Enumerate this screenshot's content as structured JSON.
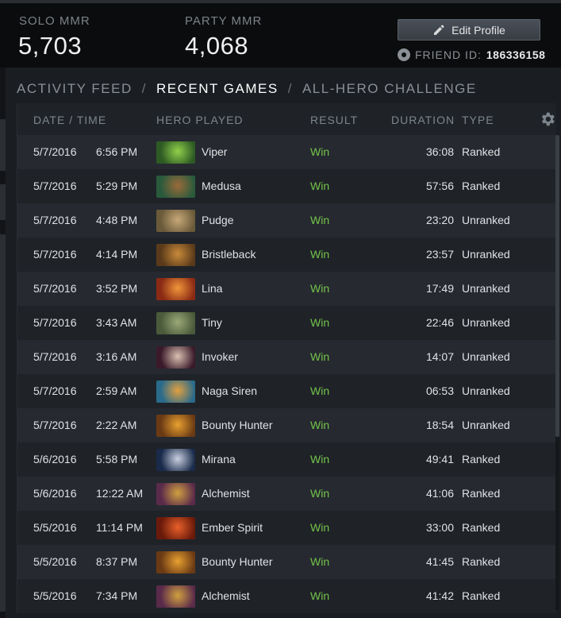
{
  "header": {
    "solo_mmr_label": "SOLO MMR",
    "solo_mmr_value": "5,703",
    "party_mmr_label": "PARTY MMR",
    "party_mmr_value": "4,068",
    "edit_profile_label": "Edit Profile",
    "friend_id_label": "FRIEND ID:",
    "friend_id_value": "186336158"
  },
  "nav": {
    "activity_feed": "ACTIVITY FEED",
    "separator": "/",
    "recent_games": "RECENT GAMES",
    "all_hero_challenge": "ALL-HERO CHALLENGE",
    "active": "recent_games"
  },
  "table": {
    "columns": {
      "date_time": "DATE / TIME",
      "hero": "HERO PLAYED",
      "result": "RESULT",
      "duration": "DURATION",
      "type": "TYPE"
    },
    "rows": [
      {
        "date": "5/7/2016",
        "time": "6:56 PM",
        "hero": "Viper",
        "result": "Win",
        "duration": "36:08",
        "type": "Ranked",
        "icon": "viper-portrait",
        "colors": [
          "#2e5a24",
          "#8fd04a"
        ]
      },
      {
        "date": "5/7/2016",
        "time": "5:29 PM",
        "hero": "Medusa",
        "result": "Win",
        "duration": "57:56",
        "type": "Ranked",
        "icon": "medusa-portrait",
        "colors": [
          "#2a5a3c",
          "#9a6a3a"
        ]
      },
      {
        "date": "5/7/2016",
        "time": "4:48 PM",
        "hero": "Pudge",
        "result": "Win",
        "duration": "23:20",
        "type": "Unranked",
        "icon": "pudge-portrait",
        "colors": [
          "#6a5a3a",
          "#c8a878"
        ]
      },
      {
        "date": "5/7/2016",
        "time": "4:14 PM",
        "hero": "Bristleback",
        "result": "Win",
        "duration": "23:57",
        "type": "Unranked",
        "icon": "bristleback-portrait",
        "colors": [
          "#5a3a1a",
          "#c88a3a"
        ]
      },
      {
        "date": "5/7/2016",
        "time": "3:52 PM",
        "hero": "Lina",
        "result": "Win",
        "duration": "17:49",
        "type": "Unranked",
        "icon": "lina-portrait",
        "colors": [
          "#8a2a14",
          "#f0963a"
        ]
      },
      {
        "date": "5/7/2016",
        "time": "3:43 AM",
        "hero": "Tiny",
        "result": "Win",
        "duration": "22:46",
        "type": "Unranked",
        "icon": "tiny-portrait",
        "colors": [
          "#4a5a3a",
          "#9aa878"
        ]
      },
      {
        "date": "5/7/2016",
        "time": "3:16 AM",
        "hero": "Invoker",
        "result": "Win",
        "duration": "14:07",
        "type": "Unranked",
        "icon": "invoker-portrait",
        "colors": [
          "#3a1a2a",
          "#d8c0b0"
        ]
      },
      {
        "date": "5/7/2016",
        "time": "2:59 AM",
        "hero": "Naga Siren",
        "result": "Win",
        "duration": "06:53",
        "type": "Unranked",
        "icon": "naga-siren-portrait",
        "colors": [
          "#2a6a8a",
          "#e0a040"
        ]
      },
      {
        "date": "5/7/2016",
        "time": "2:22 AM",
        "hero": "Bounty Hunter",
        "result": "Win",
        "duration": "18:54",
        "type": "Unranked",
        "icon": "bounty-hunter-portrait",
        "colors": [
          "#6a3a14",
          "#e8a030"
        ]
      },
      {
        "date": "5/6/2016",
        "time": "5:58 PM",
        "hero": "Mirana",
        "result": "Win",
        "duration": "49:41",
        "type": "Ranked",
        "icon": "mirana-portrait",
        "colors": [
          "#1a2a4a",
          "#c8d0e0"
        ]
      },
      {
        "date": "5/6/2016",
        "time": "12:22 AM",
        "hero": "Alchemist",
        "result": "Win",
        "duration": "41:06",
        "type": "Ranked",
        "icon": "alchemist-portrait",
        "colors": [
          "#5a2a4a",
          "#d0a040"
        ]
      },
      {
        "date": "5/5/2016",
        "time": "11:14 PM",
        "hero": "Ember Spirit",
        "result": "Win",
        "duration": "33:00",
        "type": "Ranked",
        "icon": "ember-spirit-portrait",
        "colors": [
          "#6a1a0a",
          "#e8602a"
        ]
      },
      {
        "date": "5/5/2016",
        "time": "8:37 PM",
        "hero": "Bounty Hunter",
        "result": "Win",
        "duration": "41:45",
        "type": "Ranked",
        "icon": "bounty-hunter-portrait",
        "colors": [
          "#6a3a14",
          "#e8a030"
        ]
      },
      {
        "date": "5/5/2016",
        "time": "7:34 PM",
        "hero": "Alchemist",
        "result": "Win",
        "duration": "41:42",
        "type": "Ranked",
        "icon": "alchemist-portrait",
        "colors": [
          "#5a2a4a",
          "#d0a040"
        ]
      }
    ]
  },
  "colors": {
    "win": "#74c34a",
    "background": "#1a1d21",
    "header_bg": "#0b0c0d"
  }
}
